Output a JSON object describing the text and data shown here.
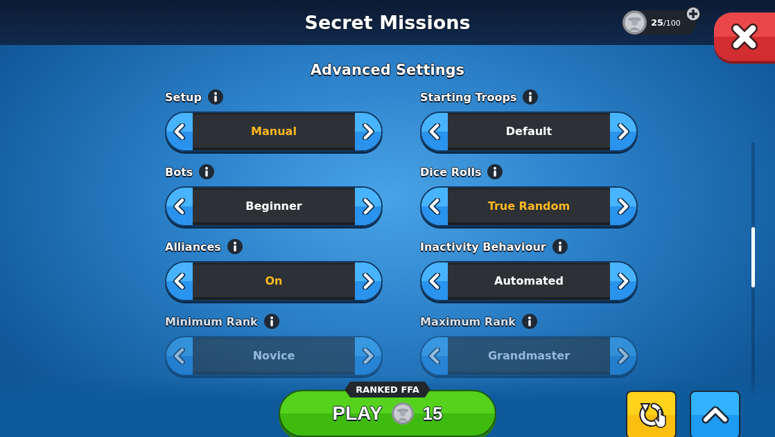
{
  "header": {
    "title": "Secret Missions",
    "currency": "25",
    "currency_max": "/100"
  },
  "section_title": "Advanced Settings",
  "settings": [
    {
      "label": "Setup",
      "value": "Manual",
      "modified": true,
      "faded": false
    },
    {
      "label": "Starting Troops",
      "value": "Default",
      "modified": false,
      "faded": false
    },
    {
      "label": "Bots",
      "value": "Beginner",
      "modified": false,
      "faded": false
    },
    {
      "label": "Dice Rolls",
      "value": "True Random",
      "modified": true,
      "faded": false
    },
    {
      "label": "Alliances",
      "value": "On",
      "modified": true,
      "faded": false
    },
    {
      "label": "Inactivity Behaviour",
      "value": "Automated",
      "modified": false,
      "faded": false
    },
    {
      "label": "Minimum Rank",
      "value": "Novice",
      "modified": false,
      "faded": true
    },
    {
      "label": "Maximum Rank",
      "value": "Grandmaster",
      "modified": false,
      "faded": true
    }
  ],
  "play": {
    "mode": "RANKED FFA",
    "label": "PLAY",
    "cost": "15"
  }
}
